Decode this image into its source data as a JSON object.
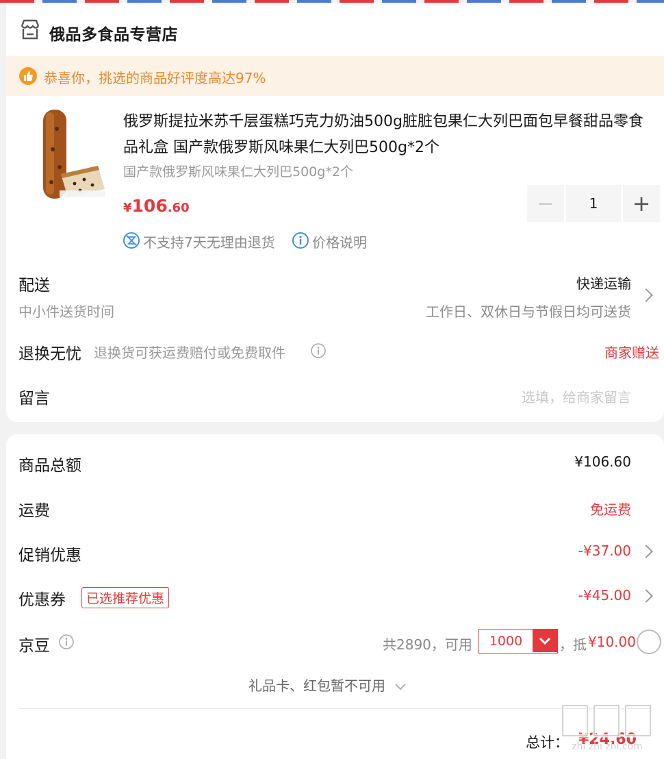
{
  "store": {
    "name": "俄品多食品专营店",
    "icon": "store-icon"
  },
  "notice": {
    "text": "恭喜你，挑选的商品好评度高达97%",
    "icon": "thumbs-up-icon"
  },
  "product": {
    "title": "俄罗斯提拉米苏千层蛋糕巧克力奶油500g脏脏包果仁大列巴面包早餐甜品零食品礼盒 国产款俄罗斯风味果仁大列巴500g*2个",
    "spec": "国产款俄罗斯风味果仁大列巴500g*2个",
    "price_symbol": "¥",
    "price_int": "106",
    "price_dec": ".60",
    "quantity": "1",
    "services": [
      {
        "icon": "no-return-icon",
        "label": "不支持7天无理由退货"
      },
      {
        "icon": "info-icon",
        "label": "价格说明"
      }
    ]
  },
  "delivery": {
    "label": "配送",
    "sub": "中小件送货时间",
    "method": "快递运输",
    "detail": "工作日、双休日与节假日均可送货"
  },
  "returns": {
    "label": "退换无忧",
    "desc": "退换货可获运费赔付或免费取件",
    "value": "商家赠送"
  },
  "message": {
    "label": "留言",
    "placeholder": "选填，给商家留言"
  },
  "summary": {
    "goods_total_label": "商品总额",
    "goods_total": "¥106.60",
    "shipping_label": "运费",
    "shipping": "免运费",
    "promo_label": "促销优惠",
    "promo": "-¥37.00",
    "coupon_label": "优惠券",
    "coupon_badge": "已选推荐优惠",
    "coupon": "-¥45.00",
    "jd_label": "京豆",
    "jd_total_text": "共2890，可用",
    "jd_use": "1000",
    "jd_deduct_prefix": "，抵",
    "jd_deduct": "¥10.00",
    "gift_card_text": "礼品卡、红包暂不可用",
    "total_label": "总计：",
    "total": "¥24.60"
  },
  "colors": {
    "accent": "#e4393c",
    "notice_bg": "#fdf2e6",
    "notice_text": "#e8892a"
  }
}
